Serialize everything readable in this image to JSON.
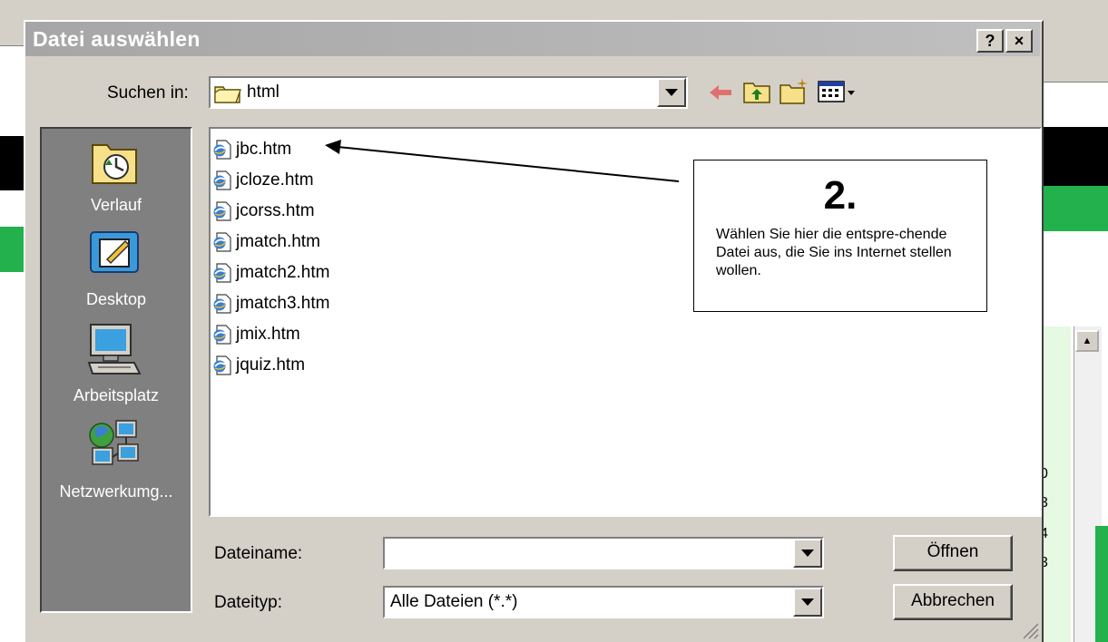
{
  "dialog": {
    "title": "Datei auswählen",
    "help_button": "?",
    "close_button": "×"
  },
  "look_in": {
    "label": "Suchen in:",
    "value": "html"
  },
  "places": [
    {
      "label": "Verlauf",
      "icon": "history-icon"
    },
    {
      "label": "Desktop",
      "icon": "desktop-icon"
    },
    {
      "label": "Arbeitsplatz",
      "icon": "my-computer-icon"
    },
    {
      "label": "Netzwerkumg...",
      "icon": "network-icon"
    }
  ],
  "files": [
    "jbc.htm",
    "jcloze.htm",
    "jcorss.htm",
    "jmatch.htm",
    "jmatch2.htm",
    "jmatch3.htm",
    "jmix.htm",
    "jquiz.htm"
  ],
  "filename": {
    "label": "Dateiname:",
    "value": ""
  },
  "filetype": {
    "label": "Dateityp:",
    "value": "Alle Dateien (*.*)"
  },
  "buttons": {
    "open": "Öffnen",
    "cancel": "Abbrechen"
  },
  "annotation": {
    "number": "2.",
    "text": "Wählen Sie hier die entspre-chende Datei aus, die Sie ins Internet stellen wollen."
  },
  "background": {
    "digits": [
      "0",
      "3",
      "4",
      "3"
    ]
  },
  "colors": {
    "dialog_face": "#d4d0c8",
    "places_bar": "#808080",
    "title_gradient": "#a6a6a6",
    "bg_green": "#22b14c"
  }
}
